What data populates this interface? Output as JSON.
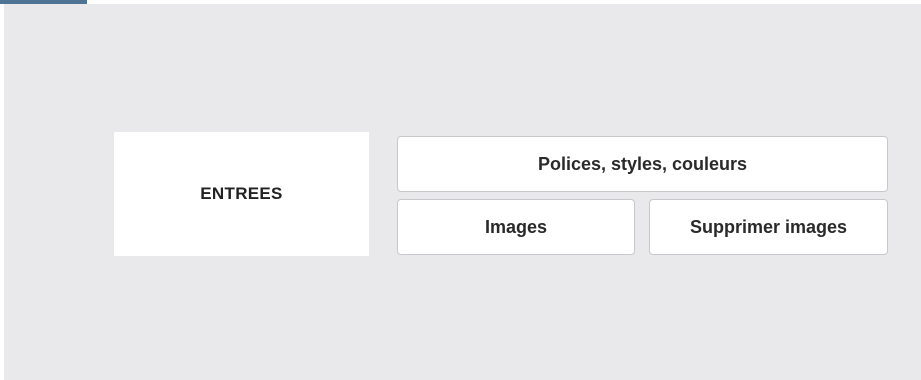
{
  "section": {
    "label": "ENTREES"
  },
  "buttons": {
    "fonts_styles_colors": "Polices, styles, couleurs",
    "images": "Images",
    "delete_images": "Supprimer images"
  },
  "colors": {
    "accent": "#4f7394",
    "panel_background": "#e9e9eb",
    "button_background": "#ffffff"
  }
}
